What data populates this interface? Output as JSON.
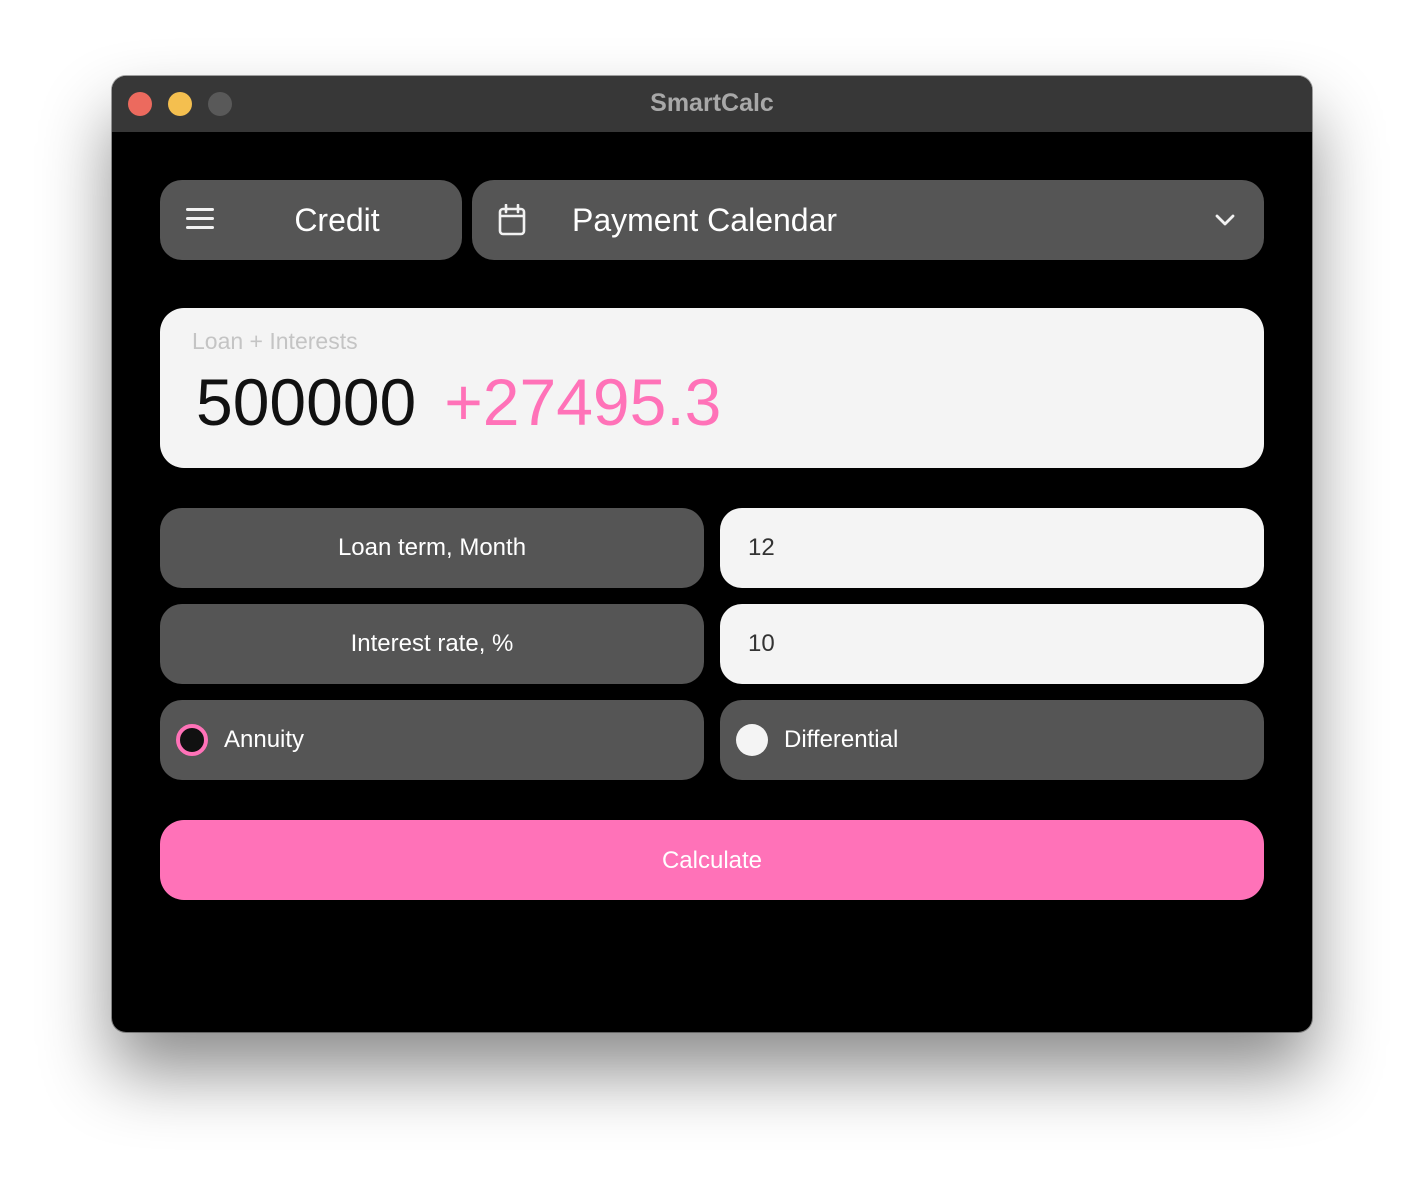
{
  "window": {
    "title": "SmartCalc"
  },
  "toolbar": {
    "mode_label": "Credit",
    "view_label": "Payment Calendar",
    "menu_icon": "hamburger-menu-icon",
    "calendar_icon": "calendar-icon",
    "dropdown_icon": "chevron-down-icon"
  },
  "result": {
    "caption": "Loan + Interests",
    "loan_amount": "500000",
    "interest_amount": "+27495.3"
  },
  "form": {
    "loan_term_label": "Loan term, Month",
    "loan_term_value": "12",
    "interest_rate_label": "Interest rate, %",
    "interest_rate_value": "10",
    "payment_types": [
      {
        "label": "Annuity",
        "selected": true
      },
      {
        "label": "Differential",
        "selected": false
      }
    ],
    "calculate_label": "Calculate"
  },
  "colors": {
    "accent": "#ff72b8",
    "background": "#000000",
    "panel": "#555555",
    "field": "#f4f4f4",
    "titlebar": "#373737"
  }
}
